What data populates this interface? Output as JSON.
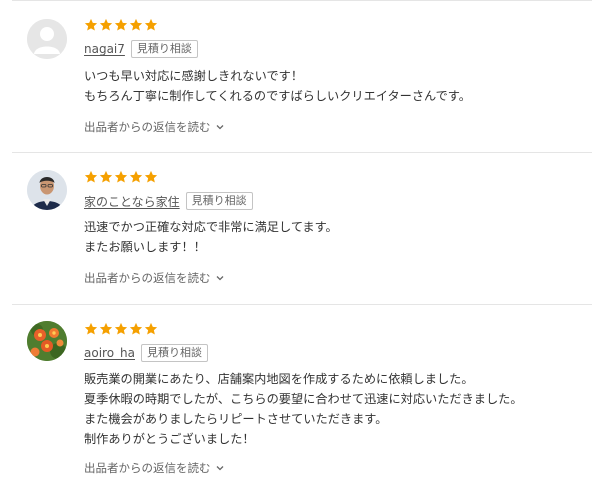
{
  "accent": {
    "star": "#f5a000"
  },
  "reviews": [
    {
      "rating": 5,
      "avatar": "default-person-icon",
      "username": "nagai7",
      "badge": "見積り相談",
      "comment": [
        "いつも早い対応に感謝しきれないです！",
        "もちろん丁寧に制作してくれるのですばらしいクリエイターさんです。"
      ],
      "reply_label": "出品者からの返信を読む"
    },
    {
      "rating": 5,
      "avatar": "person-photo",
      "username": "家のことなら家住",
      "badge": "見積り相談",
      "comment": [
        "迅速でかつ正確な対応で非常に満足してます。",
        "またお願いします！！"
      ],
      "reply_label": "出品者からの返信を読む"
    },
    {
      "rating": 5,
      "avatar": "flower-photo",
      "username": "aoiro_ha",
      "badge": "見積り相談",
      "comment": [
        "販売業の開業にあたり、店舗案内地図を作成するために依頼しました。",
        "夏季休暇の時期でしたが、こちらの要望に合わせて迅速に対応いただきました。",
        "また機会がありましたらリピートさせていただきます。",
        "制作ありがとうございました！"
      ],
      "reply_label": "出品者からの返信を読む"
    }
  ]
}
